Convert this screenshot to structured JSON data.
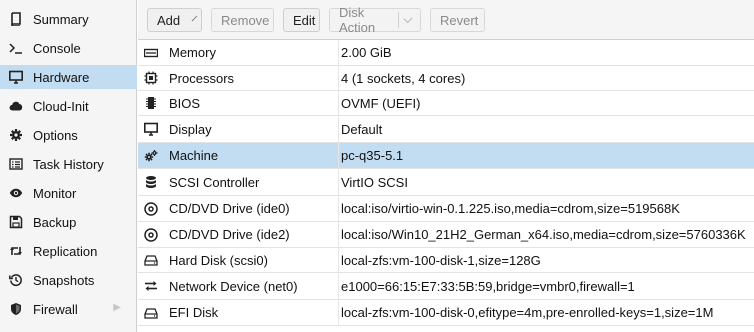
{
  "sidebar": {
    "items": [
      {
        "label": "Summary",
        "icon": "book-icon",
        "active": false
      },
      {
        "label": "Console",
        "icon": "terminal-icon",
        "active": false
      },
      {
        "label": "Hardware",
        "icon": "desktop-icon",
        "active": true
      },
      {
        "label": "Cloud-Init",
        "icon": "cloud-icon",
        "active": false
      },
      {
        "label": "Options",
        "icon": "gear-icon",
        "active": false
      },
      {
        "label": "Task History",
        "icon": "list-icon",
        "active": false
      },
      {
        "label": "Monitor",
        "icon": "eye-icon",
        "active": false
      },
      {
        "label": "Backup",
        "icon": "floppy-icon",
        "active": false
      },
      {
        "label": "Replication",
        "icon": "retweet-icon",
        "active": false
      },
      {
        "label": "Snapshots",
        "icon": "history-icon",
        "active": false
      },
      {
        "label": "Firewall",
        "icon": "shield-icon",
        "active": false
      }
    ]
  },
  "toolbar": {
    "add_label": "Add",
    "remove_label": "Remove",
    "edit_label": "Edit",
    "disk_action_label": "Disk Action",
    "revert_label": "Revert"
  },
  "hardware": {
    "rows": [
      {
        "key": "Memory",
        "value": "2.00 GiB",
        "icon": "memory-icon"
      },
      {
        "key": "Processors",
        "value": "4 (1 sockets, 4 cores)",
        "icon": "cpu-icon"
      },
      {
        "key": "BIOS",
        "value": "OVMF (UEFI)",
        "icon": "microchip-icon"
      },
      {
        "key": "Display",
        "value": "Default",
        "icon": "desktop-icon"
      },
      {
        "key": "Machine",
        "value": "pc-q35-5.1",
        "icon": "cogs-icon"
      },
      {
        "key": "SCSI Controller",
        "value": "VirtIO SCSI",
        "icon": "database-icon"
      },
      {
        "key": "CD/DVD Drive (ide0)",
        "value": "local:iso/virtio-win-0.1.225.iso,media=cdrom,size=519568K",
        "icon": "cdrom-icon"
      },
      {
        "key": "CD/DVD Drive (ide2)",
        "value": "local:iso/Win10_21H2_German_x64.iso,media=cdrom,size=5760336K",
        "icon": "cdrom-icon"
      },
      {
        "key": "Hard Disk (scsi0)",
        "value": "local-zfs:vm-100-disk-1,size=128G",
        "icon": "hdd-icon"
      },
      {
        "key": "Network Device (net0)",
        "value": "e1000=66:15:E7:33:5B:59,bridge=vmbr0,firewall=1",
        "icon": "exchange-icon"
      },
      {
        "key": "EFI Disk",
        "value": "local-zfs:vm-100-disk-0,efitype=4m,pre-enrolled-keys=1,size=1M",
        "icon": "hdd-icon"
      }
    ]
  }
}
